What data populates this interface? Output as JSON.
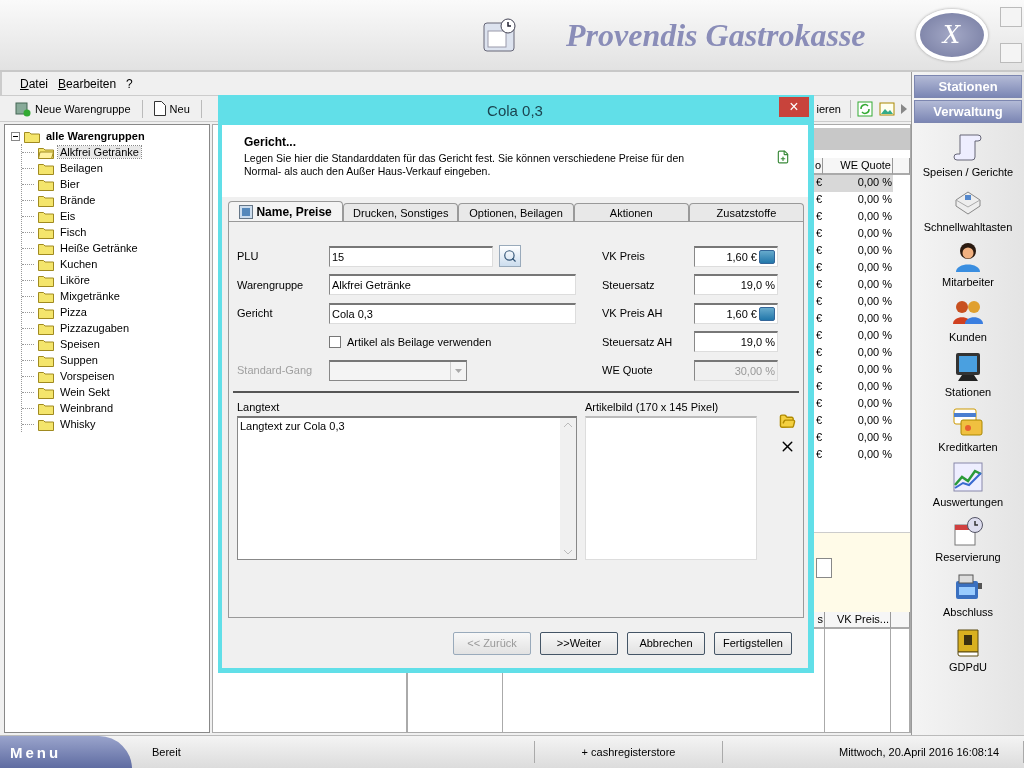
{
  "header": {
    "title": "Provendis Gastrokasse",
    "close_label": "X"
  },
  "menu": [
    {
      "label": "Datei"
    },
    {
      "label": "Bearbeiten"
    },
    {
      "label": "?"
    }
  ],
  "toolbar": {
    "left": [
      {
        "label": "Neue Warengruppe"
      },
      {
        "label": "Neu"
      }
    ],
    "right": [
      {
        "label": "ieren"
      }
    ]
  },
  "tree": {
    "label": "alle Warengruppen",
    "expanded": true,
    "children": [
      {
        "label": "Alkfrei Getränke",
        "selected": true
      },
      {
        "label": "Beilagen",
        "selected": false
      },
      {
        "label": "Bier",
        "selected": false
      },
      {
        "label": "Brände",
        "selected": false
      },
      {
        "label": "Eis",
        "selected": false
      },
      {
        "label": "Fisch",
        "selected": false
      },
      {
        "label": "Heiße Getränke",
        "selected": false
      },
      {
        "label": "Kuchen",
        "selected": false
      },
      {
        "label": "Liköre",
        "selected": false
      },
      {
        "label": "Mixgetränke",
        "selected": false
      },
      {
        "label": "Pizza",
        "selected": false
      },
      {
        "label": "Pizzazugaben",
        "selected": false
      },
      {
        "label": "Speisen",
        "selected": false
      },
      {
        "label": "Suppen",
        "selected": false
      },
      {
        "label": "Vorspeisen",
        "selected": false
      },
      {
        "label": "Wein Sekt",
        "selected": false
      },
      {
        "label": "Weinbrand",
        "selected": false
      },
      {
        "label": "Whisky",
        "selected": false
      }
    ]
  },
  "table": {
    "columns": [
      "o",
      "WE Quote"
    ],
    "rows": [
      {
        "column_1": "€",
        "we_quote": "0,00 %",
        "selected": true
      },
      {
        "column_1": "€",
        "we_quote": "0,00 %",
        "selected": false
      },
      {
        "column_1": "€",
        "we_quote": "0,00 %",
        "selected": false
      },
      {
        "column_1": "€",
        "we_quote": "0,00 %",
        "selected": false
      },
      {
        "column_1": "€",
        "we_quote": "0,00 %",
        "selected": false
      },
      {
        "column_1": "€",
        "we_quote": "0,00 %",
        "selected": false
      },
      {
        "column_1": "€",
        "we_quote": "0,00 %",
        "selected": false
      },
      {
        "column_1": "€",
        "we_quote": "0,00 %",
        "selected": false
      },
      {
        "column_1": "€",
        "we_quote": "0,00 %",
        "selected": false
      },
      {
        "column_1": "€",
        "we_quote": "0,00 %",
        "selected": false
      },
      {
        "column_1": "€",
        "we_quote": "0,00 %",
        "selected": false
      },
      {
        "column_1": "€",
        "we_quote": "0,00 %",
        "selected": false
      },
      {
        "column_1": "€",
        "we_quote": "0,00 %",
        "selected": false
      },
      {
        "column_1": "€",
        "we_quote": "0,00 %",
        "selected": false
      },
      {
        "column_1": "€",
        "we_quote": "0,00 %",
        "selected": false
      },
      {
        "column_1": "€",
        "we_quote": "0,00 %",
        "selected": false
      },
      {
        "column_1": "€",
        "we_quote": "0,00 %",
        "selected": false
      }
    ]
  },
  "lower_table": {
    "columns": [
      "s",
      "VK Preis..."
    ]
  },
  "sidebar": {
    "sections": [
      {
        "label": "Stationen"
      },
      {
        "label": "Verwaltung"
      }
    ],
    "items": [
      {
        "label": "Speisen / Gerichte"
      },
      {
        "label": "Schnellwahltasten"
      },
      {
        "label": "Mitarbeiter"
      },
      {
        "label": "Kunden"
      },
      {
        "label": "Stationen"
      },
      {
        "label": "Kreditkarten"
      },
      {
        "label": "Auswertungen"
      },
      {
        "label": "Reservierung"
      },
      {
        "label": "Abschluss"
      },
      {
        "label": "GDPdU"
      }
    ]
  },
  "status_bar": {
    "menu": "Menu",
    "segments": [
      "Bereit",
      "+ cashregisterstore",
      "Mittwoch, 20.April 2016 16:08:14"
    ]
  },
  "dialog": {
    "title": "Cola 0,3",
    "close": "×",
    "heading": "Gericht...",
    "description": "Legen Sie hier die Standarddaten für das Gericht fest. Sie können verschiedene Preise für den Normal- als auch den Außer Haus-Verkauf eingeben.",
    "tabs": [
      {
        "label": "Name, Preise",
        "selected": true
      },
      {
        "label": "Drucken, Sonstiges",
        "selected": false
      },
      {
        "label": "Optionen, Beilagen",
        "selected": false
      },
      {
        "label": "Aktionen",
        "selected": false
      },
      {
        "label": "Zusatzstoffe",
        "selected": false
      }
    ],
    "fields_left": [
      {
        "kind": "text",
        "label": "PLU",
        "value": "15",
        "lookup": true
      },
      {
        "kind": "text",
        "label": "Warengruppe",
        "value": "Alkfrei Getränke",
        "lookup": false
      },
      {
        "kind": "text",
        "label": "Gericht",
        "value": "Cola 0,3",
        "lookup": false
      },
      {
        "kind": "checkbox",
        "label": "Artikel als Beilage verwenden",
        "checked": false
      },
      {
        "kind": "select",
        "label": "Standard-Gang",
        "disabled": true
      }
    ],
    "fields_right": [
      {
        "label": "VK Preis",
        "value": "1,60 €",
        "calculator": true,
        "disabled": false
      },
      {
        "label": "Steuersatz",
        "value": "19,0 %",
        "calculator": false,
        "disabled": false
      },
      {
        "label": "VK Preis AH",
        "value": "1,60 €",
        "calculator": true,
        "disabled": false
      },
      {
        "label": "Steuersatz AH",
        "value": "19,0 %",
        "calculator": false,
        "disabled": false
      },
      {
        "label": "WE Quote",
        "value": "30,00 %",
        "calculator": false,
        "disabled": true
      }
    ],
    "langtext": {
      "label": "Langtext",
      "value": "Langtext zur Cola 0,3"
    },
    "image": {
      "label": "Artikelbild (170 x 145 Pixel)"
    },
    "buttons": [
      {
        "label": "<< Zurück",
        "disabled": true
      },
      {
        "label": ">>Weiter",
        "disabled": false
      },
      {
        "label": "Abbrechen",
        "disabled": false
      },
      {
        "label": "Fertigstellen",
        "disabled": false
      }
    ]
  }
}
